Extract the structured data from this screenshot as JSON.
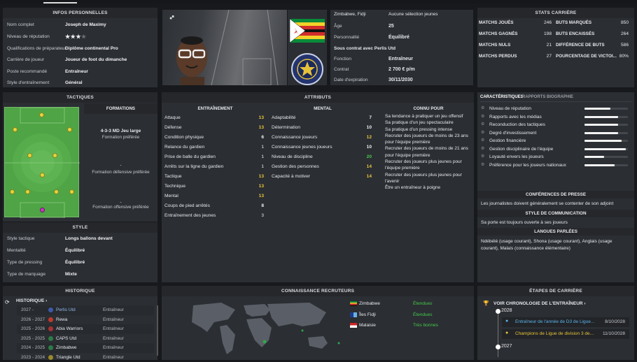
{
  "personal": {
    "header": "INFOS PERSONNELLES",
    "rows": [
      {
        "k": "Nom complet",
        "v": "Joseph de Maximy"
      },
      {
        "k": "Niveau de réputation",
        "v": ""
      },
      {
        "k": "Qualifications de préparateur",
        "v": "Diplôme continental Pro"
      },
      {
        "k": "Carrière de joueur",
        "v": "Joueur de foot du dimanche"
      },
      {
        "k": "Poste recommandé",
        "v": "Entraîneur"
      },
      {
        "k": "Style d'entraînement",
        "v": "Général"
      }
    ],
    "reputation_stars": 2.5
  },
  "profile": {
    "age_label": "Âge",
    "age": "25",
    "nationality": "Zimbabwe, Fidji",
    "youth": "Aucune sélection jeunes",
    "personality_label": "Personnalité",
    "personality": "Équilibré",
    "contract_title": "Sous contrat avec Perlis Utd",
    "function_label": "Fonction",
    "function": "Entraîneur",
    "contract_label": "Contrat",
    "contract": "2 700 € p/m",
    "expiry_label": "Date d'expiration",
    "expiry": "30/11/2030",
    "club_badge_text": "PERLIS UNITED"
  },
  "career_stats": {
    "header": "STATS CARRIÈRE",
    "left": [
      {
        "k": "MATCHS JOUÉS",
        "v": "246"
      },
      {
        "k": "MATCHS GAGNÉS",
        "v": "198"
      },
      {
        "k": "MATCHS NULS",
        "v": "21"
      },
      {
        "k": "MATCHS PERDUS",
        "v": "27"
      }
    ],
    "right": [
      {
        "k": "BUTS MARQUÉS",
        "v": "850"
      },
      {
        "k": "BUTS ENCAISSÉS",
        "v": "264"
      },
      {
        "k": "DIFFÉRENCE DE BUTS",
        "v": "586"
      },
      {
        "k": "POURCENTAGE DE VICTOI...",
        "v": "80%"
      }
    ]
  },
  "tactics": {
    "header": "TACTIQUES",
    "formations_header": "FORMATIONS",
    "f1": "4-3-3 MD Jeu large",
    "f1_sub": "Formation préférée",
    "f2": "-",
    "f2_sub": "Formation défensive préférée",
    "f3": "-",
    "f3_sub": "Formation offensive préférée"
  },
  "style": {
    "header": "STYLE",
    "rows": [
      {
        "k": "Style tactique",
        "v": "Longs ballons devant"
      },
      {
        "k": "Mentalité",
        "v": "Équilibré"
      },
      {
        "k": "Type de pressing",
        "v": "Équilibré"
      },
      {
        "k": "Type de marquage",
        "v": "Mixte"
      }
    ]
  },
  "attributes": {
    "header": "ATTRIBUTS",
    "training_header": "ENTRAÎNEMENT",
    "training": [
      {
        "k": "Attaque",
        "v": "13"
      },
      {
        "k": "Défense",
        "v": "13"
      },
      {
        "k": "Condition physique",
        "v": "6"
      },
      {
        "k": "Relance du gardien",
        "v": "1"
      },
      {
        "k": "Prise de balle du gardien",
        "v": "1"
      },
      {
        "k": "Arrêts sur la ligne du gardien",
        "v": "1"
      },
      {
        "k": "Tactique",
        "v": "13"
      },
      {
        "k": "Technique",
        "v": "13"
      },
      {
        "k": "Mental",
        "v": "13"
      },
      {
        "k": "Coups de pied arrêtés",
        "v": "8"
      },
      {
        "k": "Entraînement des jeunes",
        "v": "3"
      }
    ],
    "mental_header": "MENTAL",
    "mental": [
      {
        "k": "Adaptabilité",
        "v": "7"
      },
      {
        "k": "Détermination",
        "v": "10"
      },
      {
        "k": "Connaissance joueurs",
        "v": "12"
      },
      {
        "k": "Connaissance jeunes joueurs",
        "v": "10"
      },
      {
        "k": "Niveau de discipline",
        "v": "20"
      },
      {
        "k": "Gestion des personnes",
        "v": "14"
      },
      {
        "k": "Capacité à motiver",
        "v": "14"
      }
    ],
    "known_header": "CONNU POUR",
    "known_for": "Sa tendance à pratiquer un jeu offensif\nSa pratique d'un jeu spectaculaire\nSa pratique d'un pressing intense\nRecruter des joueurs de moins de 23 ans pour l'équipe première\nRecruter des joueurs de moins de 21 ans pour l'équipe première\nRecruter des joueurs plus jeunes pour l'équipe première\nRecruter des joueurs plus jeunes pour l'avenir\nÊtre un entraîneur à poigne"
  },
  "characteristics": {
    "tabs": [
      "CARACTÉRISTIQUES",
      "RAPPORTS",
      "BIOGRAPHIE"
    ],
    "items": [
      {
        "label": "Niveau de réputation",
        "level": 0.6
      },
      {
        "label": "Rapports avec les médias",
        "level": 0.78
      },
      {
        "label": "Reconduction des tactiques",
        "level": 0.78
      },
      {
        "label": "Degré d'investissement",
        "level": 0.78
      },
      {
        "label": "Gestion financière",
        "level": 0.85
      },
      {
        "label": "Gestion disciplinaire de l'équipe",
        "level": 0.95
      },
      {
        "label": "Loyauté envers les joueurs",
        "level": 0.45
      },
      {
        "label": "Préférence pour les joueurs nationaux",
        "level": 0.7
      }
    ],
    "press_header": "CONFÉRENCES DE PRESSE",
    "press_text": "Les journalistes doivent généralement se contenter de son adjoint",
    "comm_header": "STYLE DE COMMUNICATION",
    "comm_text": "Sa porte est toujours ouverte à ses joueurs",
    "lang_header": "LANGUES PARLÉES",
    "lang_text": "Ndébélé (usage courant), Shona (usage courant), Anglais (usage courant), Malais (connaissance élémentaire)"
  },
  "history": {
    "header": "HISTORIQUE",
    "link": "HISTORIQUE",
    "rows": [
      {
        "years": "2027 -",
        "club": "Perlis Utd",
        "role": "Entraîneur"
      },
      {
        "years": "2026 - 2027",
        "club": "Rewa",
        "role": "Entraîneur"
      },
      {
        "years": "2025 - 2026",
        "club": "Abia Warriors",
        "role": "Entraîneur"
      },
      {
        "years": "2025 - 2025",
        "club": "CAPS Utd",
        "role": "Entraîneur"
      },
      {
        "years": "2024 - 2025",
        "club": "Zimbabwe",
        "role": "Entraîneur"
      },
      {
        "years": "2023 - 2024",
        "club": "Triangle Utd",
        "role": "Entraîneur"
      }
    ]
  },
  "scouting": {
    "header": "CONNAISSANCE RECRUTEURS",
    "rows": [
      {
        "country": "Zimbabwe",
        "level": "Étendues"
      },
      {
        "country": "Îles Fidji",
        "level": "Étendues"
      },
      {
        "country": "Malaisie",
        "level": "Très bonnes"
      }
    ]
  },
  "milestones": {
    "header": "ÉTAPES DE CARRIÈRE",
    "link": "VOIR CHRONOLOGIE DE L'ENTRAÎNEUR",
    "year1": "2028",
    "items": [
      {
        "text": "Entraîneur de l'année de D3 de Ligue...",
        "date": "8/10/2028"
      },
      {
        "text": "Champions de Ligue de division 3 de...",
        "date": "11/10/2028"
      }
    ],
    "year2": "2027"
  },
  "colors": {
    "accent_yellow": "#e8c53a",
    "accent_green": "#45c84b",
    "panel": "#2b2e33",
    "bg": "#17191d"
  }
}
